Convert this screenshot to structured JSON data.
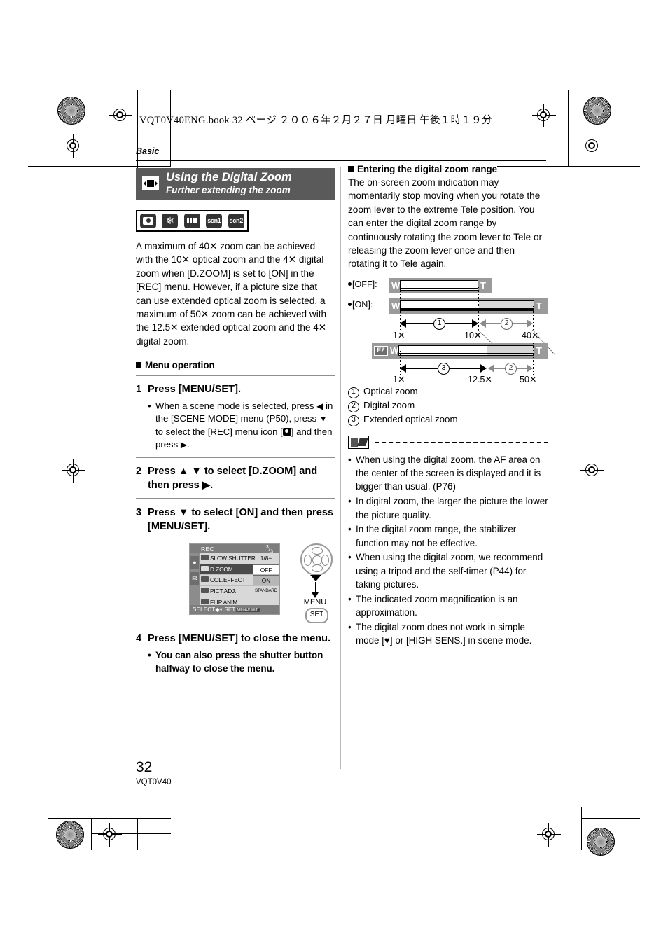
{
  "header": {
    "file_line": "VQT0V40ENG.book   32 ページ   ２００６年２月２７日   月曜日   午後１時１９分",
    "section": "Basic"
  },
  "left": {
    "title": "Using the Digital Zoom",
    "subtitle": "Further extending the zoom",
    "mode_icons": [
      "camera-mode-icon",
      "macro-mode-icon",
      "motion-picture-mode-icon",
      "scn1",
      "scn2"
    ],
    "intro": "A maximum of 40✕ zoom can be achieved with the 10✕ optical zoom and the 4✕ digital zoom when [D.ZOOM] is set to [ON] in the [REC] menu. However, if a picture size that can use extended optical zoom is selected, a maximum of 50✕ zoom can be achieved with the 12.5✕ extended optical zoom and the 4✕ digital zoom.",
    "menu_operation_heading": "Menu operation",
    "steps": [
      {
        "num": "1",
        "text": "Press [MENU/SET].",
        "bullets": [
          "When a scene mode is selected, press ◀ in the [SCENE MODE] menu (P50), press ▼ to select the [REC] menu icon [ ] and then press ▶."
        ]
      },
      {
        "num": "2",
        "text": "Press ▲ ▼ to select [D.ZOOM] and then press ▶.",
        "bullets": []
      },
      {
        "num": "3",
        "text": "Press ▼ to select [ON] and then press [MENU/SET].",
        "bullets": []
      },
      {
        "num": "4",
        "text": "Press [MENU/SET] to close the menu.",
        "bullets": [
          "You can also press the shutter button halfway to close the menu."
        ]
      }
    ],
    "lcd": {
      "title": "REC",
      "page": "3/3",
      "page_num": "3",
      "page_den": "3",
      "tabs": [
        "rec-tab-icon",
        "setup-tab-icon"
      ],
      "rows": [
        {
          "label": "SLOW SHUTTER",
          "value": "1/8−",
          "value_style": "plain"
        },
        {
          "label": "D.ZOOM",
          "value": "OFF",
          "value_style": "white"
        },
        {
          "label": "COL.EFFECT",
          "value": "ON",
          "value_style": "selected"
        },
        {
          "label": "PICT.ADJ.",
          "value": "STANDARD",
          "value_style": "plain"
        },
        {
          "label": "FLIP ANIM.",
          "value": "",
          "value_style": "plain"
        }
      ],
      "footer_select": "SELECT",
      "footer_set": "SET",
      "footer_badge": "MENU/SET"
    },
    "dpad": {
      "menu_label": "MENU",
      "set_label": "SET"
    }
  },
  "right": {
    "heading": "Entering the digital zoom range",
    "paragraph": "The on-screen zoom indication may momentarily stop moving when you rotate the zoom lever to the extreme Tele position. You can enter the digital zoom range by continuously rotating the zoom lever to Tele or releasing the zoom lever once and then rotating it to Tele again.",
    "diagram": {
      "label_off": "[OFF]:",
      "label_on": "[ON]:",
      "ez_badge": "EZ",
      "wide_label": "W",
      "tele_label": "T",
      "ticks_row1": [
        "1✕",
        "10✕",
        "40✕"
      ],
      "ticks_row2": [
        "1✕",
        "12.5✕",
        "50✕"
      ],
      "callout_optical": "1",
      "callout_digital": "2",
      "callout_extended": "3"
    },
    "legend": [
      {
        "num": "1",
        "text": "Optical zoom"
      },
      {
        "num": "2",
        "text": "Digital zoom"
      },
      {
        "num": "3",
        "text": "Extended optical zoom"
      }
    ],
    "notes": [
      "When using the digital zoom, the AF area on the center of the screen is displayed and it is bigger than usual. (P76)",
      "In digital zoom, the larger the picture the lower the picture quality.",
      "In the digital zoom range, the stabilizer function may not be effective.",
      "When using the digital zoom, we recommend using a tripod and the self-timer (P44) for taking pictures.",
      "The indicated zoom magnification is an approximation.",
      "The digital zoom does not work in simple mode [♥] or [HIGH SENS.] in scene mode."
    ]
  },
  "footer": {
    "page_number": "32",
    "doc_code": "VQT0V40"
  }
}
